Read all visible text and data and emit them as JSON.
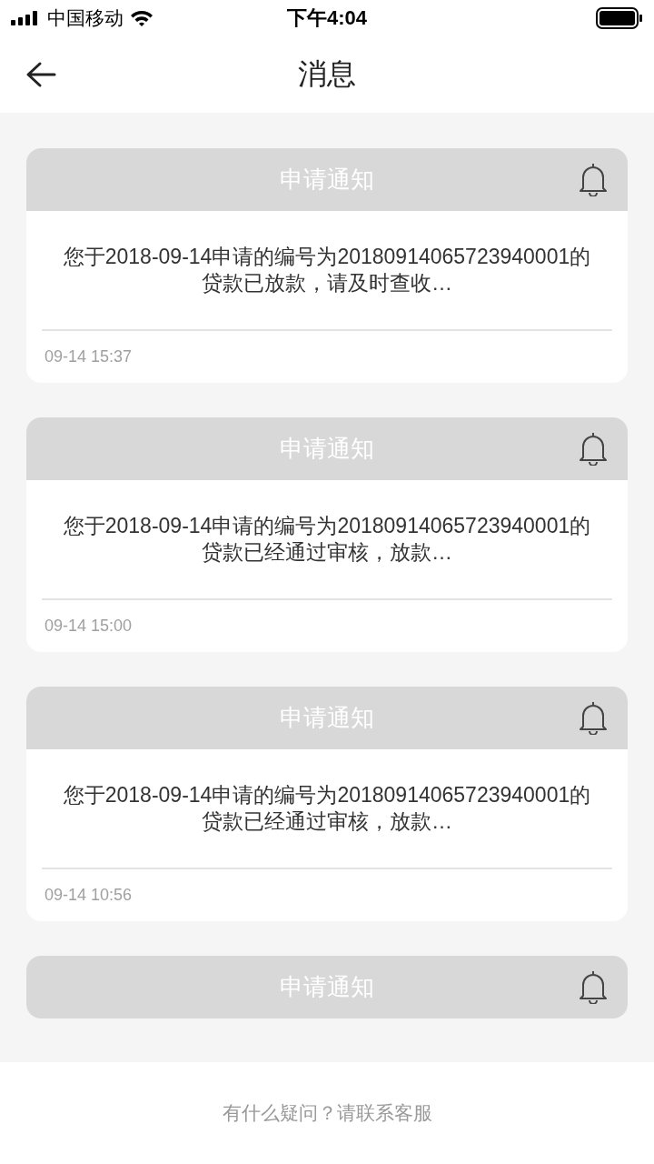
{
  "status_bar": {
    "carrier": "中国移动",
    "time": "下午4:04"
  },
  "nav": {
    "title": "消息"
  },
  "messages": [
    {
      "title": "申请通知",
      "body": "您于2018-09-14申请的编号为20180914065723940001的贷款已放款，请及时查收…",
      "time": "09-14 15:37"
    },
    {
      "title": "申请通知",
      "body": "您于2018-09-14申请的编号为20180914065723940001的贷款已经通过审核，放款…",
      "time": "09-14 15:00"
    },
    {
      "title": "申请通知",
      "body": "您于2018-09-14申请的编号为20180914065723940001的贷款已经通过审核，放款…",
      "time": "09-14 10:56"
    },
    {
      "title": "申请通知"
    }
  ],
  "footer": {
    "text": "有什么疑问？请联系客服"
  }
}
